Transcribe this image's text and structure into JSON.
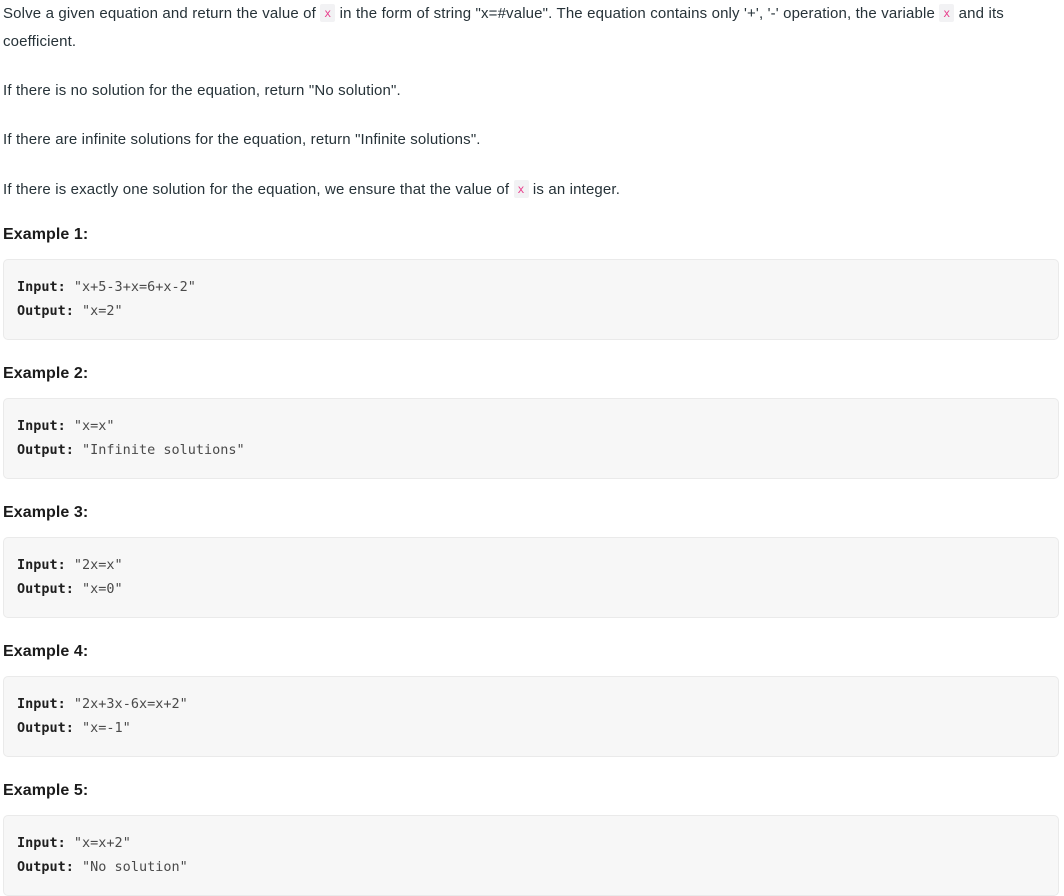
{
  "description": {
    "paragraphs": [
      {
        "id": "p1",
        "segments": [
          {
            "type": "text",
            "text": "Solve a given equation and return the value of "
          },
          {
            "type": "code",
            "text": "x"
          },
          {
            "type": "text",
            "text": " in the form of string \"x=#value\". The equation contains only '+', '-' operation, the variable "
          },
          {
            "type": "code",
            "text": "x"
          },
          {
            "type": "text",
            "text": " and its coefficient."
          }
        ]
      },
      {
        "id": "p2",
        "segments": [
          {
            "type": "text",
            "text": "If there is no solution for the equation, return \"No solution\"."
          }
        ]
      },
      {
        "id": "p3",
        "segments": [
          {
            "type": "text",
            "text": "If there are infinite solutions for the equation, return \"Infinite solutions\"."
          }
        ]
      },
      {
        "id": "p4",
        "segments": [
          {
            "type": "text",
            "text": "If there is exactly one solution for the equation, we ensure that the value of "
          },
          {
            "type": "code",
            "text": "x"
          },
          {
            "type": "text",
            "text": " is an integer."
          }
        ]
      }
    ]
  },
  "examples": [
    {
      "title": "Example 1:",
      "input_label": "Input:",
      "input_value": "\"x+5-3+x=6+x-2\"",
      "output_label": "Output:",
      "output_value": "\"x=2\""
    },
    {
      "title": "Example 2:",
      "input_label": "Input:",
      "input_value": "\"x=x\"",
      "output_label": "Output:",
      "output_value": "\"Infinite solutions\""
    },
    {
      "title": "Example 3:",
      "input_label": "Input:",
      "input_value": "\"2x=x\"",
      "output_label": "Output:",
      "output_value": "\"x=0\""
    },
    {
      "title": "Example 4:",
      "input_label": "Input:",
      "input_value": "\"2x+3x-6x=x+2\"",
      "output_label": "Output:",
      "output_value": "\"x=-1\""
    },
    {
      "title": "Example 5:",
      "input_label": "Input:",
      "input_value": "\"x=x+2\"",
      "output_label": "Output:",
      "output_value": "\"No solution\""
    }
  ],
  "colors": {
    "page_background": "#ffffff",
    "body_text": "#263238",
    "heading_text": "#1a1a1a",
    "inline_code_text": "#e83e8c",
    "inline_code_background": "#f2f2f4",
    "code_block_background": "#f7f7f7",
    "code_block_border": "#eaeaea",
    "code_block_text": "#2f2f2f"
  }
}
